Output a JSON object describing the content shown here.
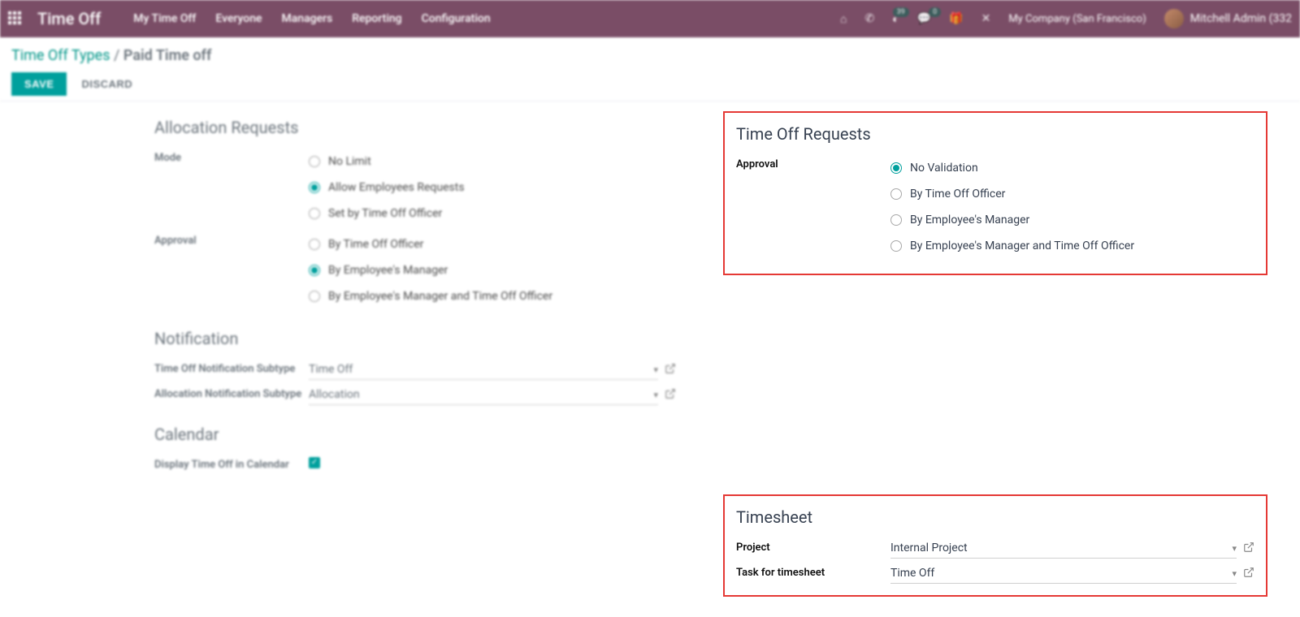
{
  "nav": {
    "brand": "Time Off",
    "items": [
      "My Time Off",
      "Everyone",
      "Managers",
      "Reporting",
      "Configuration"
    ],
    "company": "My Company (San Francisco)",
    "user": "Mitchell Admin (332",
    "badge1": "39",
    "badge2": "0"
  },
  "breadcrumb": {
    "parent": "Time Off Types",
    "current": "Paid Time off"
  },
  "buttons": {
    "save": "SAVE",
    "discard": "DISCARD"
  },
  "left": {
    "allocation": {
      "title": "Allocation Requests",
      "mode_label": "Mode",
      "mode_options": [
        "No Limit",
        "Allow Employees Requests",
        "Set by Time Off Officer"
      ],
      "mode_selected": 1,
      "approval_label": "Approval",
      "approval_options": [
        "By Time Off Officer",
        "By Employee's Manager",
        "By Employee's Manager and Time Off Officer"
      ],
      "approval_selected": 1
    },
    "notification": {
      "title": "Notification",
      "timeoff_sub_label": "Time Off Notification Subtype",
      "timeoff_sub_value": "Time Off",
      "alloc_sub_label": "Allocation Notification Subtype",
      "alloc_sub_value": "Allocation"
    },
    "calendar": {
      "title": "Calendar",
      "display_label": "Display Time Off in Calendar"
    }
  },
  "right": {
    "requests": {
      "title": "Time Off Requests",
      "approval_label": "Approval",
      "options": [
        "No Validation",
        "By Time Off Officer",
        "By Employee's Manager",
        "By Employee's Manager and Time Off Officer"
      ],
      "selected": 0
    },
    "timesheet": {
      "title": "Timesheet",
      "project_label": "Project",
      "project_value": "Internal Project",
      "task_label": "Task for timesheet",
      "task_value": "Time Off"
    }
  }
}
